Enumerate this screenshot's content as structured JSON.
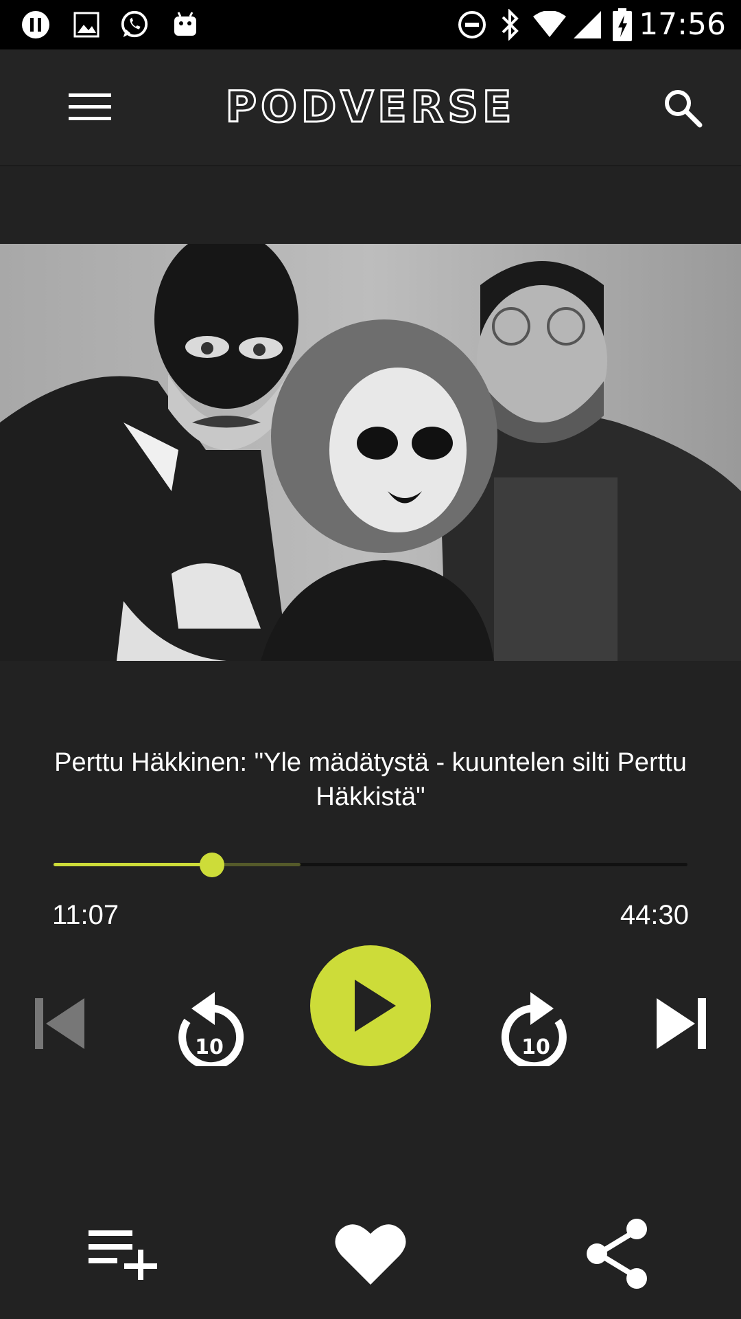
{
  "status_bar": {
    "time": "17:56",
    "icons": [
      "pause-notification-icon",
      "image-icon",
      "whatsapp-icon",
      "android-icon",
      "do-not-disturb-icon",
      "bluetooth-icon",
      "wifi-icon",
      "signal-icon",
      "battery-charging-icon"
    ]
  },
  "app_bar": {
    "title": "PODVERSE",
    "menu_icon": "hamburger-menu-icon",
    "search_icon": "search-icon"
  },
  "episode": {
    "title": "Perttu Häkkinen: \"Yle mädätystä - kuuntelen silti Perttu Häkkistä\""
  },
  "player": {
    "elapsed": "11:07",
    "duration": "44:30",
    "progress_fraction": 0.25,
    "buffered_fraction": 0.39,
    "skip_back_seconds": "10",
    "skip_forward_seconds": "10",
    "accent_color": "#cddc39"
  },
  "bottom_actions": [
    "add-to-queue-icon",
    "favorite-heart-icon",
    "share-icon"
  ]
}
